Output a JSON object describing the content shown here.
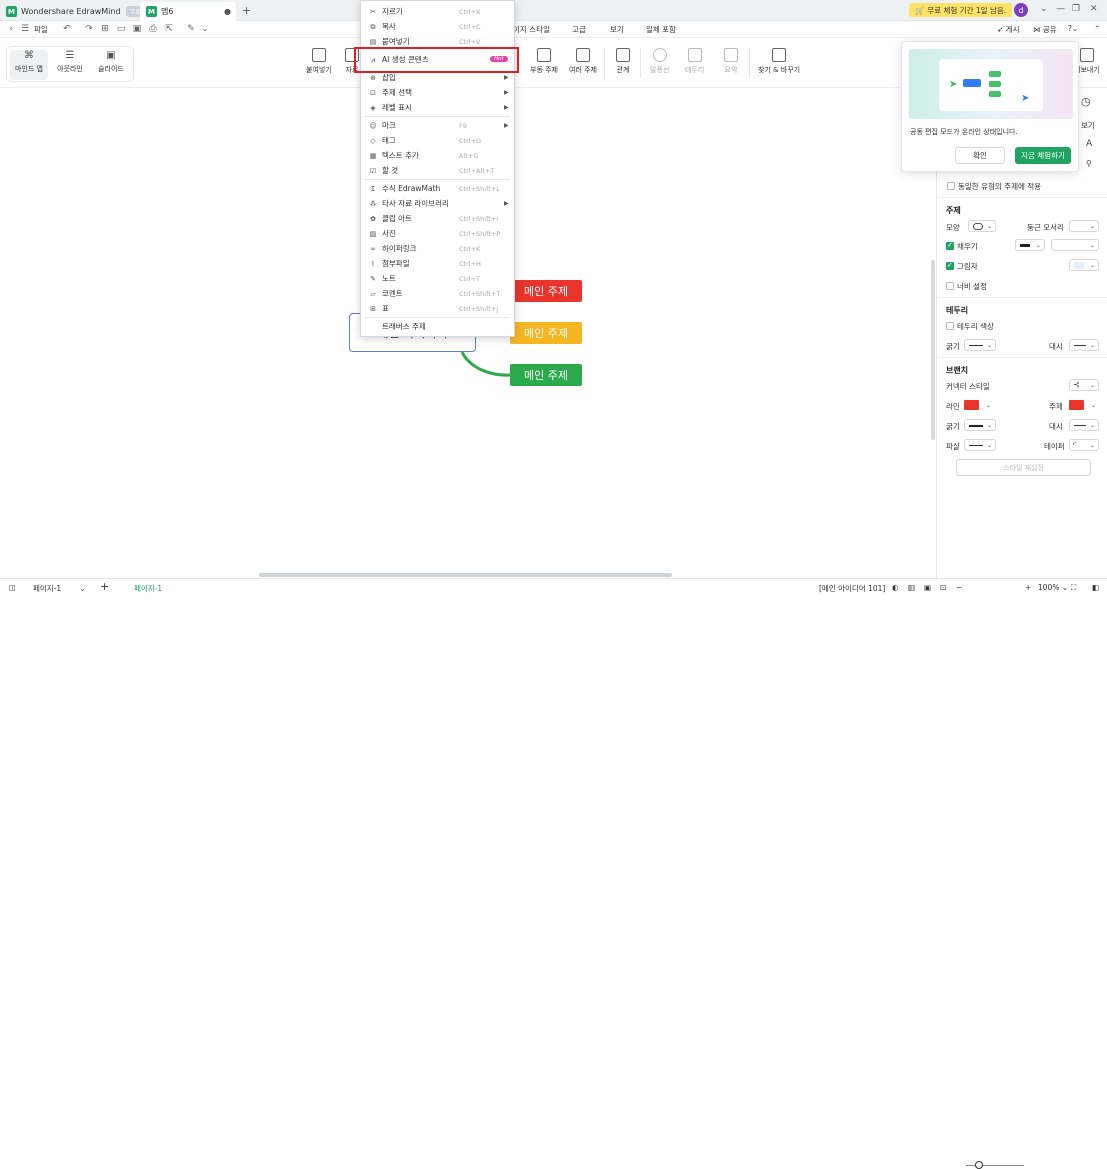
{
  "titlebar": {
    "app_name": "Wondershare EdrawMind",
    "free_badge": "무료",
    "doc_tab": "맵6",
    "new_tab": "+",
    "trial": "무료 체험 기간 1일 남음.",
    "avatar_letter": "d"
  },
  "menubar": {
    "file": "파일",
    "menus": [
      "이지 스타일",
      "고급",
      "보기",
      "일체 포함"
    ],
    "publish": "게시",
    "share": "공유"
  },
  "ribbon": {
    "views": [
      "마인드 맵",
      "아웃라인",
      "슬라이드"
    ],
    "buttons": [
      "붙여넣기",
      "자료",
      "부동 주제",
      "여러 주제",
      "관계",
      "말풍선",
      "테두리",
      "요약",
      "찾기 & 바꾸기"
    ],
    "export_label": "내보내기"
  },
  "context_menu": {
    "items": [
      {
        "label": "자르기",
        "shortcut": "Ctrl+X",
        "icon": "scissors-icon"
      },
      {
        "label": "복사",
        "shortcut": "Ctrl+C",
        "icon": "copy-icon"
      },
      {
        "label": "붙여넣기",
        "shortcut": "Ctrl+V",
        "icon": "paste-icon"
      },
      {
        "label": "AI 생성 콘텐츠",
        "shortcut": "",
        "icon": "ai-icon",
        "badge": "Hot"
      },
      {
        "label": "삽입",
        "shortcut": "",
        "icon": "insert-icon",
        "submenu": true
      },
      {
        "label": "주제 선택",
        "shortcut": "",
        "icon": "select-topic-icon",
        "submenu": true
      },
      {
        "label": "레벨 표시",
        "shortcut": "",
        "icon": "layers-icon",
        "submenu": true
      },
      {
        "label": "마크",
        "shortcut": "F9",
        "icon": "mark-icon",
        "submenu": true
      },
      {
        "label": "태그",
        "shortcut": "Ctrl+G",
        "icon": "tag-icon"
      },
      {
        "label": "텍스트 추가",
        "shortcut": "Alt+G",
        "icon": "text-add-icon"
      },
      {
        "label": "할 것",
        "shortcut": "Ctrl+Alt+T",
        "icon": "todo-icon"
      },
      {
        "label": "수식 EdrawMath",
        "shortcut": "Ctrl+Shift+L",
        "icon": "sigma-icon"
      },
      {
        "label": "타사 자료 라이브러리",
        "shortcut": "",
        "icon": "library-icon",
        "submenu": true
      },
      {
        "label": "클립 아트",
        "shortcut": "Ctrl+Shift+I",
        "icon": "clipart-icon"
      },
      {
        "label": "사진",
        "shortcut": "Ctrl+Shift+P",
        "icon": "image-icon"
      },
      {
        "label": "하이퍼링크",
        "shortcut": "Ctrl+K",
        "icon": "link-icon"
      },
      {
        "label": "첨부파일",
        "shortcut": "Ctrl+H",
        "icon": "attachment-icon"
      },
      {
        "label": "노트",
        "shortcut": "Ctrl+T",
        "icon": "note-icon"
      },
      {
        "label": "코멘트",
        "shortcut": "Ctrl+Shift+T",
        "icon": "comment-icon"
      },
      {
        "label": "표",
        "shortcut": "Ctrl+Shift+J",
        "icon": "table-icon"
      },
      {
        "label": "트래버스 주제",
        "shortcut": "",
        "icon": ""
      }
    ]
  },
  "canvas": {
    "central_topic": "메인 아이디어",
    "main_topics": [
      {
        "label": "메인 주제",
        "color": "#e8342a"
      },
      {
        "label": "메인 주제",
        "color": "#f5b622"
      },
      {
        "label": "메인 주제",
        "color": "#2aaa4a"
      }
    ]
  },
  "popup": {
    "text": "공동 편집 모드가 온라인 상태입니다.",
    "ok": "확인",
    "try": "지금 체험하기"
  },
  "right_panel": {
    "view_label": "보기",
    "apply_same": "동일한 유형의 주제에 적용",
    "topic_header": "주제",
    "shape_label": "모양",
    "round_corner_label": "둥근 모서리",
    "fill_label": "채우기",
    "shadow_label": "그림자",
    "width_label": "너비 설정",
    "border_header": "테두리",
    "border_color_label": "테두리 색상",
    "thickness_label": "굵기",
    "dash_label": "대시",
    "branch_header": "브랜치",
    "connector_style_label": "커넥터 스타일",
    "line_label": "라인",
    "topic_label": "주제",
    "wave_label": "파샬",
    "taper_label": "테이퍼",
    "reset_style": "스타일 재설정",
    "line_color": "#e8342a",
    "topic_color": "#e8342a"
  },
  "statusbar": {
    "page_dropdown": "페이지-1",
    "page_tab": "페이지-1",
    "selection": "[메인 아이디어 101]",
    "zoom": "100%"
  }
}
